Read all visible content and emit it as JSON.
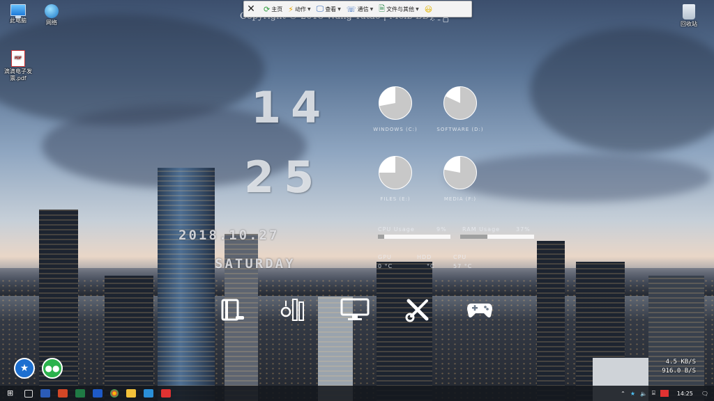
{
  "desktop_icons": [
    {
      "label": "此电脑",
      "icon": "this-pc-icon"
    },
    {
      "label": "网络",
      "icon": "network-icon"
    },
    {
      "label": "滴滴电子发票.pdf",
      "icon": "pdf-file-icon"
    },
    {
      "label": "回收站",
      "icon": "recycle-bin-icon"
    }
  ],
  "toolbar": {
    "items": [
      {
        "label": "主页",
        "icon": "refresh-icon"
      },
      {
        "label": "动作",
        "icon": "lightning-icon"
      },
      {
        "label": "查看",
        "icon": "monitor-icon"
      },
      {
        "label": "通信",
        "icon": "phone-icon"
      },
      {
        "label": "文件与其他",
        "icon": "file-icon"
      }
    ],
    "emoji": "😃"
  },
  "copyright": "Copyright © 2018 Wang Yutao | Melb   BD)",
  "clock": {
    "hour": "14",
    "minute": "25",
    "date": "2018.10.27",
    "weekday": "SATURDAY"
  },
  "disks": [
    {
      "label": "WINDOWS (C:)",
      "used": 0.72
    },
    {
      "label": "SOFTWARE (D:)",
      "used": 0.82
    },
    {
      "label": "FILES (E:)",
      "used": 0.75
    },
    {
      "label": "MEDIA (F:)",
      "used": 0.78
    }
  ],
  "stats": {
    "cpu_label": "CPU Usage",
    "cpu_value": "9%",
    "cpu_fraction": 0.09,
    "ram_label": "RAM Usage",
    "ram_value": "37%",
    "ram_fraction": 0.37,
    "gpu_label": "GPU",
    "gpu_value": "0 °C",
    "hdd_label": "HDD",
    "hdd_value": "°C",
    "cpu_temp_label": "CPU",
    "cpu_temp_value": "57 °C"
  },
  "launchers": [
    "book-icon",
    "tools-icon",
    "monitor-icon",
    "wrench-screwdriver-icon",
    "gamepad-icon"
  ],
  "net": {
    "up": "4.5 KB/S",
    "down": "916.0 B/S"
  },
  "taskbar": {
    "time": "14:25"
  },
  "colors": {
    "toolbar_bg": "#f3f3f3",
    "gauge_fill": "#c8c8c8",
    "gauge_empty": "#ffffff"
  }
}
